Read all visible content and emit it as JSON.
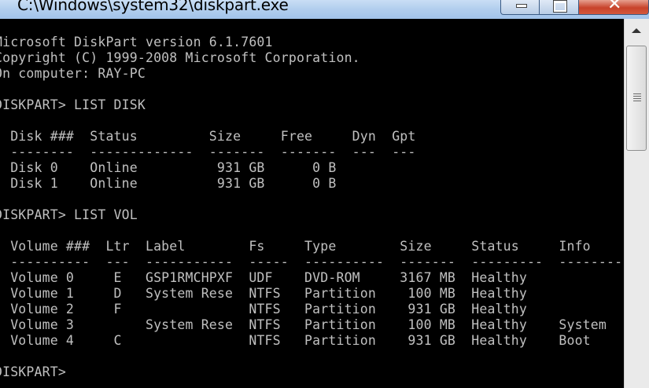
{
  "window": {
    "title": "C:\\Windows\\system32\\diskpart.exe",
    "minimize_icon": "minimize-icon",
    "maximize_icon": "maximize-icon",
    "close_icon": "close-icon",
    "close_glyph": "✕"
  },
  "console": {
    "lines": [
      "Microsoft DiskPart version 6.1.7601",
      "Copyright (C) 1999-2008 Microsoft Corporation.",
      "On computer: RAY-PC",
      "",
      "DISKPART> LIST DISK",
      "",
      "  Disk ###  Status         Size     Free     Dyn  Gpt",
      "  --------  -------------  -------  -------  ---  ---",
      "  Disk 0    Online          931 GB      0 B",
      "  Disk 1    Online          931 GB      0 B",
      "",
      "DISKPART> LIST VOL",
      "",
      "  Volume ###  Ltr  Label        Fs     Type        Size     Status     Info",
      "  ----------  ---  -----------  -----  ----------  -------  ---------  --------",
      "  Volume 0     E   GSP1RMCHPXF  UDF    DVD-ROM     3167 MB  Healthy",
      "  Volume 1     D   System Rese  NTFS   Partition    100 MB  Healthy",
      "  Volume 2     F                NTFS   Partition    931 GB  Healthy",
      "  Volume 3         System Rese  NTFS   Partition    100 MB  Healthy    System",
      "  Volume 4     C                NTFS   Partition    931 GB  Healthy    Boot",
      "",
      "DISKPART> "
    ]
  }
}
